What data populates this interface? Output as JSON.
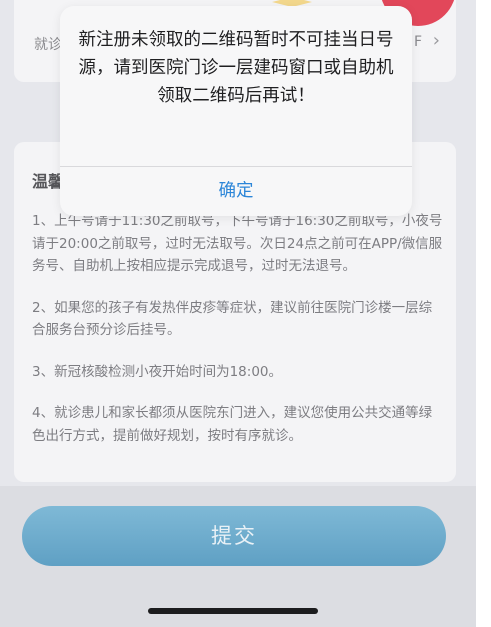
{
  "top_row": {
    "label": "就诊",
    "value": "F"
  },
  "notice": {
    "title": "温馨",
    "paragraphs": [
      "1、上午号请于11:30之前取号，下午号请于16:30之前取号，小夜号请于20:00之前取号，过时无法取号。次日24点之前可在APP/微信服务号、自助机上按相应提示完成退号，过时无法退号。",
      "2、如果您的孩子有发热伴皮疹等症状，建议前往医院门诊楼一层综合服务台预分诊后挂号。",
      "3、新冠核酸检测小夜开始时间为18:00。",
      "4、就诊患儿和家长都须从医院东门进入，建议您使用公共交通等绿色出行方式，提前做好规划，按时有序就诊。"
    ]
  },
  "submit": {
    "label": "提交"
  },
  "alert": {
    "message": "新注册未领取的二维码暂时不可挂当日号源，请到医院门诊一层建码窗口或自助机领取二维码后再试！",
    "confirm_label": "确定"
  },
  "colors": {
    "accent": "#2c86d8",
    "button": "#6aa9cc",
    "badge": "#e2475a"
  }
}
